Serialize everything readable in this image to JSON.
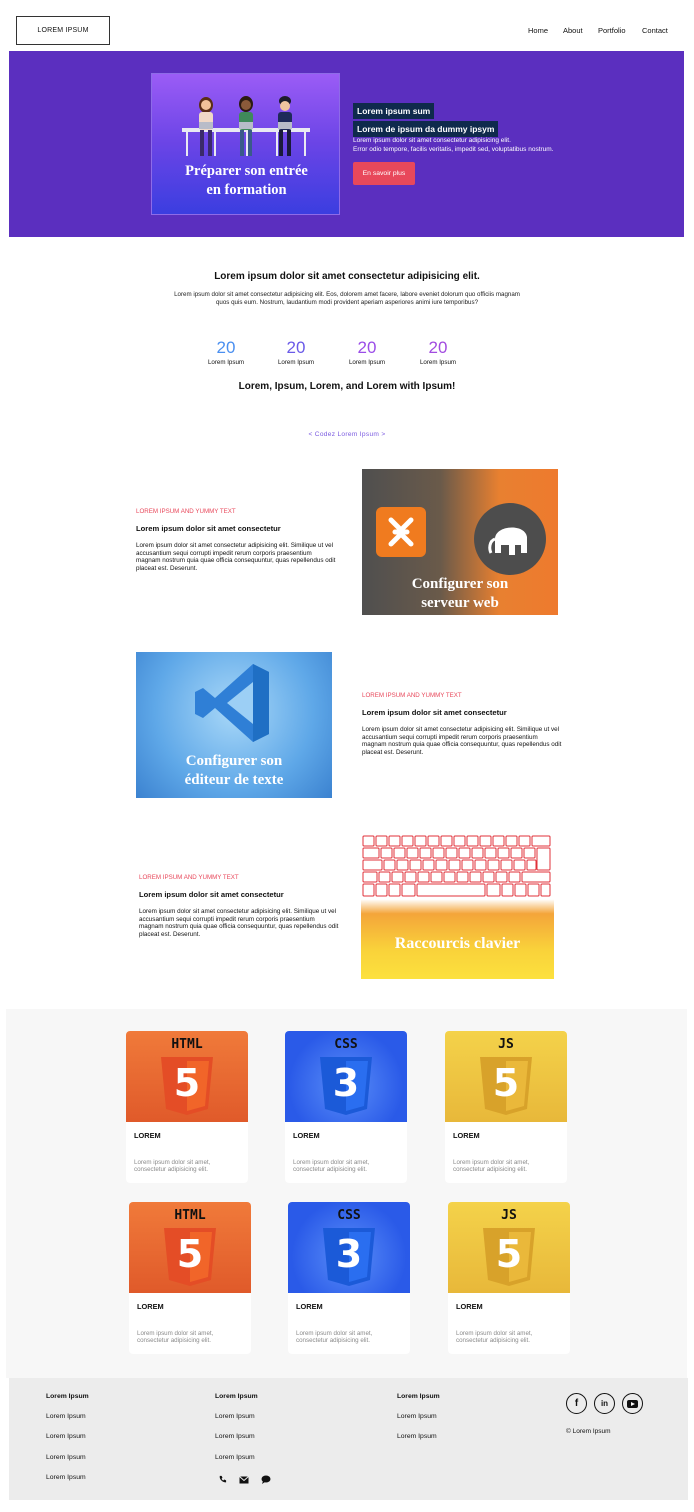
{
  "header": {
    "logo": "LOREM IPSUM",
    "nav": [
      "Home",
      "About",
      "Portfolio",
      "Contact"
    ]
  },
  "hero": {
    "card_title_line1": "Préparer son entrée",
    "card_title_line2": "en formation",
    "headline_line1": "Lorem ipsum sum",
    "headline_line2": "Lorem de ipsum da dummy ipsym",
    "paragraph_line1": "Lorem ipsum dolor sit amet consectetur adipisicing elit.",
    "paragraph_line2": "Error odio tempore, facilis veritatis, impedit sed, voluptatibus nostrum.",
    "button": "En savoir plus"
  },
  "intro": {
    "heading": "Lorem ipsum dolor sit amet consectetur adipisicing elit.",
    "paragraph": "Lorem ipsum dolor sit amet consectetur adipisicing elit. Eos, dolorem amet facere, labore eveniet dolorum quo officiis magnam quos quis eum. Nostrum, laudantium modi provident aperiam asperiores animi iure temporibus?"
  },
  "stats": [
    {
      "value": "20",
      "label": "Lorem Ipsum",
      "color": "#4a8ff0"
    },
    {
      "value": "20",
      "label": "Lorem Ipsum",
      "color": "#6a5ae8"
    },
    {
      "value": "20",
      "label": "Lorem Ipsum",
      "color": "#9b4de8"
    },
    {
      "value": "20",
      "label": "Lorem Ipsum",
      "color": "#a24be0"
    }
  ],
  "summary": "Lorem, Ipsum, Lorem, and Lorem with Ipsum!",
  "codez": "< Codez Lorem Ipsum >",
  "features": [
    {
      "kicker": "LOREM IPSUM AND YUMMY TEXT",
      "title": "Lorem ipsum dolor sit amet consectetur",
      "text": "Lorem ipsum dolor sit amet consectetur adipisicing elit. Similique ut vel accusantium sequi corrupti impedit rerum corporis praesentium magnam nostrum quia quae officia consequuntur, quas repellendus odit placeat est. Deserunt.",
      "image_title_line1": "Configurer son",
      "image_title_line2": "serveur web"
    },
    {
      "kicker": "LOREM IPSUM AND YUMMY TEXT",
      "title": "Lorem ipsum dolor sit amet consectetur",
      "text": "Lorem ipsum dolor sit amet consectetur adipisicing elit. Similique ut vel accusantium sequi corrupti impedit rerum corporis praesentium magnam nostrum quia quae officia consequuntur, quas repellendus odit placeat est. Deserunt.",
      "image_title_line1": "Configurer son",
      "image_title_line2": "éditeur de texte"
    },
    {
      "kicker": "LOREM IPSUM AND YUMMY TEXT",
      "title": "Lorem ipsum dolor sit amet consectetur",
      "text": "Lorem ipsum dolor sit amet consectetur adipisicing elit. Similique ut vel accusantium sequi corrupti impedit rerum corporis praesentium magnam nostrum quia quae officia consequuntur, quas repellendus odit placeat est. Deserunt.",
      "image_title_line1": "Raccourcis clavier"
    }
  ],
  "cards": [
    {
      "badge": "HTML",
      "number": "5",
      "title": "LOREM",
      "text": "Lorem ipsum dolor sit amet, consectetur adipisicing elit."
    },
    {
      "badge": "CSS",
      "number": "3",
      "title": "LOREM",
      "text": "Lorem ipsum dolor sit amet, consectetur adipisicing elit."
    },
    {
      "badge": "JS",
      "number": "5",
      "title": "LOREM",
      "text": "Lorem ipsum dolor sit amet, consectetur adipisicing elit."
    },
    {
      "badge": "HTML",
      "number": "5",
      "title": "LOREM",
      "text": "Lorem ipsum dolor sit amet, consectetur adipisicing elit."
    },
    {
      "badge": "CSS",
      "number": "3",
      "title": "LOREM",
      "text": "Lorem ipsum dolor sit amet, consectetur adipisicing elit."
    },
    {
      "badge": "JS",
      "number": "5",
      "title": "LOREM",
      "text": "Lorem ipsum dolor sit amet, consectetur adipisicing elit."
    }
  ],
  "footer": {
    "col1": {
      "heading": "Lorem Ipsum",
      "items": [
        "Lorem Ipsum",
        "Lorem Ipsum",
        "Lorem Ipsum",
        "Lorem Ipsum"
      ]
    },
    "col2": {
      "heading": "Lorem Ipsum",
      "items": [
        "Lorem Ipsum",
        "Lorem Ipsum",
        "Lorem Ipsum"
      ]
    },
    "col3": {
      "heading": "Lorem Ipsum",
      "items": [
        "Lorem Ipsum",
        "Lorem Ipsum"
      ]
    },
    "social": [
      "facebook-icon",
      "linkedin-icon",
      "youtube-icon"
    ],
    "copyright": "© Lorem Ipsum",
    "contact_icons": [
      "phone-icon",
      "mail-icon",
      "chat-icon"
    ]
  }
}
